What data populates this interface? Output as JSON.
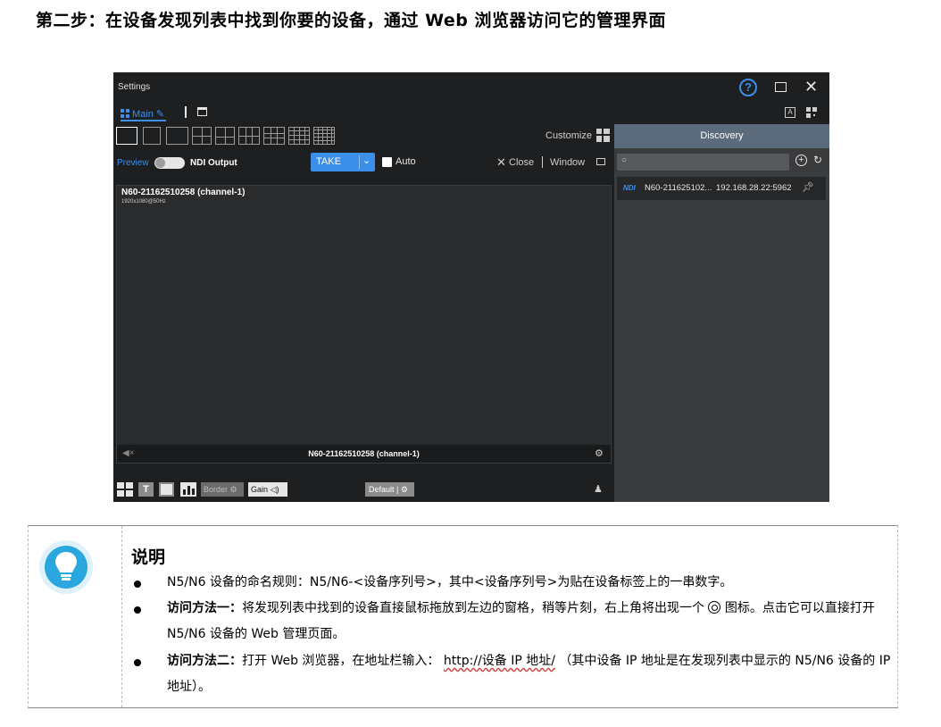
{
  "doc_title": "第二步：在设备发现列表中找到你要的设备，通过 Web 浏览器访问它的管理界面",
  "app": {
    "window_title": "Settings",
    "tab_main": "Main",
    "customize": "Customize",
    "preview": "Preview",
    "ndi_output": "NDI Output",
    "take": "TAKE",
    "auto": "Auto",
    "close": "Close",
    "window": "Window",
    "pane_title": "N60-21162510258 (channel-1)",
    "pane_sub": "1920x1080@50Hz",
    "pane_footer_title": "N60-21162510258 (channel-1)",
    "bottom": {
      "text_btn": "T",
      "border": "Border",
      "gain": "Gain",
      "default": "Default"
    },
    "discovery": {
      "header": "Discovery",
      "devices": [
        {
          "badge": "NDI",
          "name": "N60-211625102...",
          "ip": "192.168.28.22:5962"
        }
      ]
    }
  },
  "note": {
    "heading": "说明",
    "item1": "N5/N6 设备的命名规则：N5/N6-<设备序列号>，其中<设备序列号>为贴在设备标签上的一串数字。",
    "item2_bold": "访问方法一：",
    "item2_a": "将发现列表中找到的设备直接鼠标拖放到左边的窗格，稍等片刻，右上角将出现一个",
    "item2_b": "图标。点击它可以直接打开 N5/N6 设备的 Web 管理页面。",
    "item3_bold": "访问方法二：",
    "item3_a": "打开 Web 浏览器，在地址栏输入：",
    "item3_url": "http://设备 IP 地址/",
    "item3_b": "（其中设备 IP 地址是在发现列表中显示的 N5/N6 设备的 IP 地址）。"
  }
}
